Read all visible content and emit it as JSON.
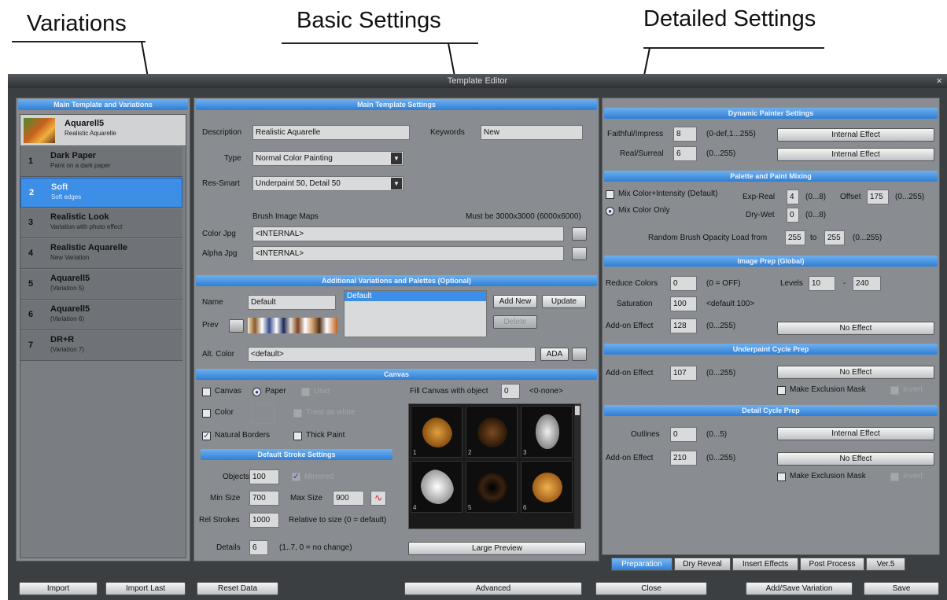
{
  "annotations": {
    "variations": "Variations",
    "basic": "Basic Settings",
    "detailed": "Detailed Settings"
  },
  "window": {
    "title": "Template Editor",
    "close": "×"
  },
  "left": {
    "header": "Main Template and Variations",
    "top_item": {
      "name": "Aquarell5",
      "sub": "Realistic Aquarelle"
    },
    "items": [
      {
        "num": "1",
        "name": "Dark Paper",
        "sub": "Paint on a dark paper"
      },
      {
        "num": "2",
        "name": "Soft",
        "sub": "Soft edges"
      },
      {
        "num": "3",
        "name": "Realistic Look",
        "sub": "Variation with photo effect"
      },
      {
        "num": "4",
        "name": "Realistic Aquarelle",
        "sub": "New Variation"
      },
      {
        "num": "5",
        "name": "Aquarell5",
        "sub": "(Variation 5)"
      },
      {
        "num": "6",
        "name": "Aquarell5",
        "sub": "(Variation 6)"
      },
      {
        "num": "7",
        "name": "DR+R",
        "sub": "(Variation 7)"
      }
    ]
  },
  "main": {
    "header": "Main Template Settings",
    "description_label": "Description",
    "description": "Realistic Aquarelle",
    "keywords_label": "Keywords",
    "keywords": "New",
    "type_label": "Type",
    "type": "Normal Color Painting",
    "res_label": "Res-Smart",
    "res": "Underpaint 50, Detail 50",
    "brush_maps": "Brush Image Maps",
    "brush_note": "Must be 3000x3000 (6000x6000)",
    "color_jpg_label": "Color Jpg",
    "color_jpg": "<INTERNAL>",
    "alpha_jpg_label": "Alpha Jpg",
    "alpha_jpg": "<INTERNAL>"
  },
  "additional": {
    "header": "Additional Variations and Palettes (Optional)",
    "name_label": "Name",
    "name": "Default",
    "prev_label": "Prev",
    "list_item": "Default",
    "add_new": "Add New",
    "update": "Update",
    "delete": "Delete",
    "alt_color_label": "Alt. Color",
    "alt_color": "<default>",
    "ada": "ADA"
  },
  "canvas": {
    "header": "Canvas",
    "canvas": "Canvas",
    "paper": "Paper",
    "user": "User",
    "color": "Color",
    "treat_white": "Treat as white",
    "natural_borders": "Natural Borders",
    "thick_paint": "Thick Paint",
    "fill_label": "Fill Canvas with object",
    "fill_value": "0",
    "fill_none": "<0-none>",
    "thumbs": [
      "1",
      "2",
      "3",
      "4",
      "5",
      "6"
    ],
    "large_preview": "Large Preview"
  },
  "stroke": {
    "header": "Default Stroke Settings",
    "objects_label": "Objects",
    "objects": "100",
    "mirrored": "Mirrored",
    "min_label": "Min Size",
    "min": "700",
    "max_label": "Max Size",
    "max": "900",
    "rel_label": "Rel Strokes",
    "rel": "1000",
    "rel_note": "Relative to size (0 = default)",
    "details_label": "Details",
    "details": "6",
    "details_note": "(1..7,  0 = no change)"
  },
  "dynamic": {
    "header": "Dynamic Painter Settings",
    "faithful_label": "Faithful/Impress",
    "faithful": "8",
    "faithful_range": "(0-def,1...255)",
    "faithful_btn": "Internal Effect",
    "real_label": "Real/Surreal",
    "real": "6",
    "real_range": "(0...255)",
    "real_btn": "Internal Effect"
  },
  "palette": {
    "header": "Palette and Paint Mixing",
    "mix_intensity": "Mix Color+Intensity (Default)",
    "mix_only": "Mix Color Only",
    "exp_label": "Exp-Real",
    "exp": "4",
    "exp_range": "(0...8)",
    "offset_label": "Offset",
    "offset": "175",
    "offset_range": "(0...255)",
    "dry_label": "Dry-Wet",
    "dry": "0",
    "dry_range": "(0...8)",
    "random_label": "Random Brush Opacity Load from",
    "random_from": "255",
    "to": "to",
    "random_to": "255",
    "random_range": "(0...255)"
  },
  "imageprep": {
    "header": "Image Prep (Global)",
    "reduce_label": "Reduce Colors",
    "reduce": "0",
    "reduce_note": "(0 = OFF)",
    "levels_label": "Levels",
    "levels_low": "10",
    "levels_dash": "-",
    "levels_high": "240",
    "sat_label": "Saturation",
    "sat": "100",
    "sat_note": "<default 100>",
    "addon_label": "Add-on Effect",
    "addon": "128",
    "addon_range": "(0...255)",
    "addon_btn": "No Effect"
  },
  "underpaint": {
    "header": "Underpaint Cycle Prep",
    "addon_label": "Add-on Effect",
    "addon": "107",
    "addon_range": "(0...255)",
    "addon_btn": "No Effect",
    "exclusion": "Make Exclusion Mask",
    "invert": "Invert"
  },
  "detail": {
    "header": "Detail Cycle Prep",
    "outlines_label": "Outlines",
    "outlines": "0",
    "outlines_range": "(0...5)",
    "outlines_btn": "Internal Effect",
    "addon_label": "Add-on Effect",
    "addon": "210",
    "addon_range": "(0...255)",
    "addon_btn": "No Effect",
    "exclusion": "Make Exclusion Mask",
    "invert": "Invert"
  },
  "tabs": [
    "Preparation",
    "Dry Reveal",
    "Insert Effects",
    "Post Process",
    "Ver.5"
  ],
  "bottom": {
    "import": "Import",
    "import_last": "Import Last",
    "reset": "Reset Data",
    "advanced": "Advanced",
    "close": "Close",
    "add_save": "Add/Save Variation",
    "save": "Save"
  }
}
